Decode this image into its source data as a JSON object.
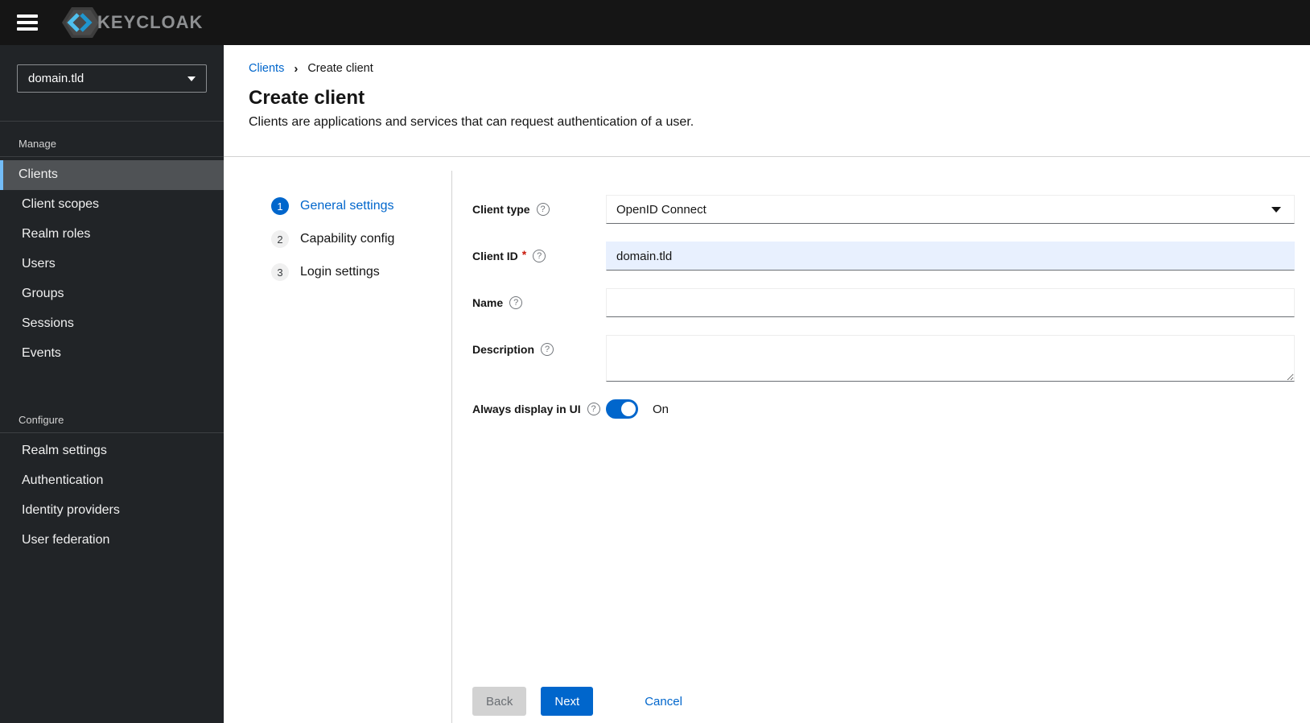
{
  "colors": {
    "accent": "#0066cc",
    "link": "#0066cc",
    "masthead-bg": "#151515",
    "sidebar-bg": "#212427",
    "sidebar-active-bg": "#4f5255",
    "sidebar-active-border": "#73bcf7",
    "autofill-bg": "#e8f0fe",
    "danger": "#c9190b",
    "divider": "#d2d2d2"
  },
  "masthead": {
    "brand": "KEYCLOAK"
  },
  "sidebar": {
    "realm_selector": {
      "value": "domain.tld"
    },
    "sections": [
      {
        "label": "Manage",
        "active_item": "Clients",
        "items": [
          {
            "label": "Clients"
          },
          {
            "label": "Client scopes"
          },
          {
            "label": "Realm roles"
          },
          {
            "label": "Users"
          },
          {
            "label": "Groups"
          },
          {
            "label": "Sessions"
          },
          {
            "label": "Events"
          }
        ]
      },
      {
        "label": "Configure",
        "items": [
          {
            "label": "Realm settings"
          },
          {
            "label": "Authentication"
          },
          {
            "label": "Identity providers"
          },
          {
            "label": "User federation"
          }
        ]
      }
    ]
  },
  "breadcrumb": {
    "items": [
      {
        "label": "Clients"
      },
      {
        "label": "Create client"
      }
    ]
  },
  "page": {
    "title": "Create client",
    "subtitle": "Clients are applications and services that can request authentication of a user."
  },
  "wizard": {
    "steps": [
      {
        "number": "1",
        "label": "General settings",
        "active": true
      },
      {
        "number": "2",
        "label": "Capability config",
        "active": false
      },
      {
        "number": "3",
        "label": "Login settings",
        "active": false
      }
    ],
    "form": {
      "client_type": {
        "label": "Client type",
        "value": "OpenID Connect"
      },
      "client_id": {
        "label": "Client ID",
        "required_marker": "*",
        "value": "domain.tld"
      },
      "name": {
        "label": "Name",
        "value": ""
      },
      "description": {
        "label": "Description",
        "value": ""
      },
      "always_display": {
        "label": "Always display in UI",
        "state_label": "On",
        "enabled": true
      }
    },
    "footer": {
      "back_label": "Back",
      "next_label": "Next",
      "cancel_label": "Cancel"
    }
  }
}
